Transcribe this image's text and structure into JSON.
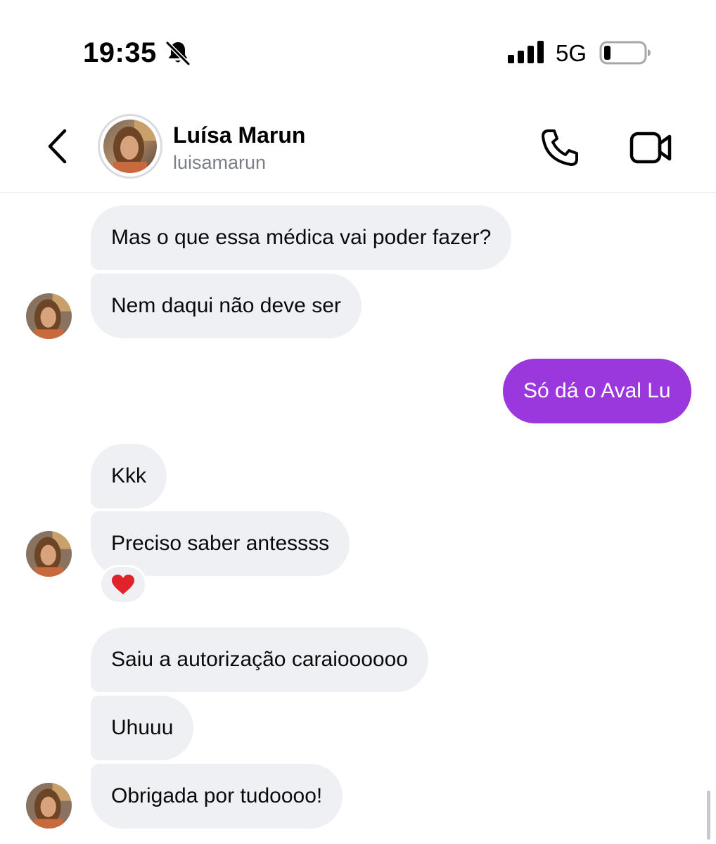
{
  "status_bar": {
    "time": "19:35",
    "network": "5G",
    "icons": [
      "bell-slash-icon",
      "signal-icon",
      "battery-icon"
    ]
  },
  "header": {
    "name": "Luísa Marun",
    "username": "luisamarun",
    "icons": [
      "back-icon",
      "avatar",
      "phone-icon",
      "video-camera-icon"
    ]
  },
  "messages": [
    {
      "from": "contact",
      "text": "Mas o que essa médica vai poder fazer?"
    },
    {
      "from": "contact",
      "text": "Nem daqui não deve ser"
    },
    {
      "from": "me",
      "text": "Só dá o Aval Lu"
    },
    {
      "from": "contact",
      "text": "Kkk"
    },
    {
      "from": "contact",
      "text": "Preciso saber antessss",
      "reaction": "❤️"
    },
    {
      "from": "contact",
      "text": "Saiu a autorização caraioooooo"
    },
    {
      "from": "contact",
      "text": "Uhuuu"
    },
    {
      "from": "contact",
      "text": "Obrigada por tudoooo!"
    }
  ],
  "colors": {
    "outgoing_bubble": "#9b38dd",
    "incoming_bubble": "#eff0f4",
    "handle_text": "#7b7f86"
  }
}
